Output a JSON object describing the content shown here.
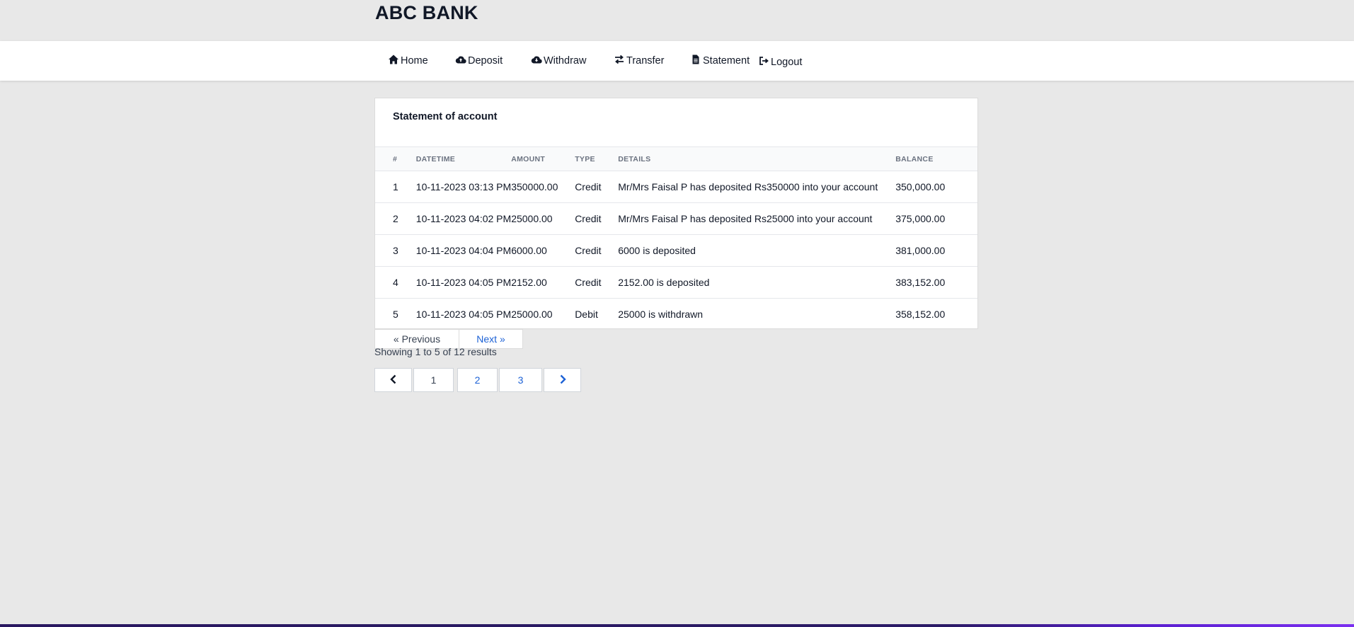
{
  "brand": "ABC BANK",
  "nav": {
    "home": "Home",
    "deposit": "Deposit",
    "withdraw": "Withdraw",
    "transfer": "Transfer",
    "statement": "Statement",
    "logout": "Logout",
    "icons": [
      "home-icon",
      "cloud-upload-icon",
      "cloud-download-icon",
      "transfer-arrows-icon",
      "document-icon",
      "logout-icon"
    ]
  },
  "statement": {
    "title": "Statement of account",
    "columns": [
      "#",
      "DATETIME",
      "AMOUNT",
      "TYPE",
      "DETAILS",
      "BALANCE"
    ],
    "rows": [
      {
        "num": "1",
        "datetime": "10-11-2023 03:13 PM",
        "amount": "350000.00",
        "type": "Credit",
        "details": "Mr/Mrs Faisal P has deposited Rs350000 into your account",
        "balance": "350,000.00"
      },
      {
        "num": "2",
        "datetime": "10-11-2023 04:02 PM",
        "amount": "25000.00",
        "type": "Credit",
        "details": "Mr/Mrs Faisal P has deposited Rs25000 into your account",
        "balance": "375,000.00"
      },
      {
        "num": "3",
        "datetime": "10-11-2023 04:04 PM",
        "amount": "6000.00",
        "type": "Credit",
        "details": "6000 is deposited",
        "balance": "381,000.00"
      },
      {
        "num": "4",
        "datetime": "10-11-2023 04:05 PM",
        "amount": "2152.00",
        "type": "Credit",
        "details": "2152.00 is deposited",
        "balance": "383,152.00"
      },
      {
        "num": "5",
        "datetime": "10-11-2023 04:05 PM",
        "amount": "25000.00",
        "type": "Debit",
        "details": "25000 is withdrawn",
        "balance": "358,152.00"
      }
    ]
  },
  "pagination": {
    "previous": "« Previous",
    "next": "Next »",
    "results_text": "Showing 1 to 5 of 12 results",
    "pages": [
      "1",
      "2",
      "3"
    ],
    "current_page": "1",
    "link_color": "#1d62d6"
  }
}
